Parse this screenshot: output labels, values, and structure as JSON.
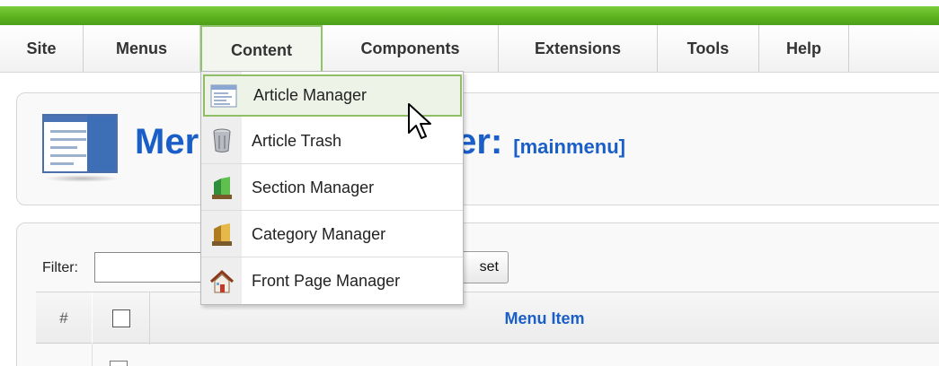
{
  "menubar": {
    "items": [
      {
        "label": "Site"
      },
      {
        "label": "Menus"
      },
      {
        "label": "Content"
      },
      {
        "label": "Components"
      },
      {
        "label": "Extensions"
      },
      {
        "label": "Tools"
      },
      {
        "label": "Help"
      }
    ],
    "active": "Content"
  },
  "dropdown": {
    "items": [
      {
        "label": "Article Manager",
        "icon": "article-manager-icon",
        "highlighted": true
      },
      {
        "label": "Article Trash",
        "icon": "trash-icon"
      },
      {
        "label": "Section Manager",
        "icon": "section-manager-icon"
      },
      {
        "label": "Category Manager",
        "icon": "category-manager-icon"
      },
      {
        "label": "Front Page Manager",
        "icon": "frontpage-icon"
      }
    ]
  },
  "page": {
    "title": "Menu Item Manager:",
    "title_visible_prefix": "Mer",
    "title_visible_suffix": "er:",
    "subtitle": "[mainmenu]"
  },
  "filter": {
    "label": "Filter:",
    "value": "",
    "reset_label": "set"
  },
  "table": {
    "headers": {
      "num": "#",
      "title": "Menu Item"
    }
  },
  "colors": {
    "accent_green": "#58b11d",
    "title_blue": "#1a5fc8",
    "hover_border": "#8fbe67"
  }
}
